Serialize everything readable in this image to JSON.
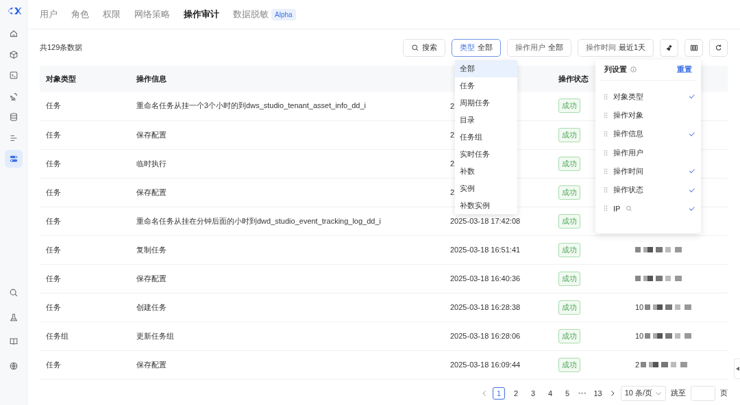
{
  "sidebar": {
    "items": [
      {
        "kind": "home",
        "selected": false
      },
      {
        "kind": "cube",
        "selected": false
      },
      {
        "kind": "terminal",
        "selected": false
      },
      {
        "kind": "dish",
        "selected": false
      },
      {
        "kind": "database",
        "selected": false
      },
      {
        "kind": "list",
        "selected": false
      },
      {
        "kind": "toggles",
        "selected": true
      }
    ],
    "bottom_items": [
      {
        "kind": "search"
      },
      {
        "kind": "flask"
      },
      {
        "kind": "book"
      },
      {
        "kind": "globe"
      }
    ]
  },
  "tabs": [
    {
      "label": "用户",
      "selected": false
    },
    {
      "label": "角色",
      "selected": false
    },
    {
      "label": "权限",
      "selected": false
    },
    {
      "label": "网络策略",
      "selected": false
    },
    {
      "label": "操作审计",
      "selected": true
    },
    {
      "label": "数据脱敏",
      "selected": false,
      "badge": "Alpha"
    }
  ],
  "total": "共129条数据",
  "toolbar": {
    "search": "搜索",
    "filters": [
      {
        "label": "类型",
        "value": "全部",
        "active": true
      },
      {
        "label": "操作用户",
        "value": "全部",
        "active": false
      },
      {
        "label": "操作时间",
        "value": "最近1天",
        "active": false
      }
    ]
  },
  "table": {
    "columns": [
      "对象类型",
      "操作信息",
      "操作状态"
    ],
    "rows": [
      {
        "type": "任务",
        "info": "重命名任务从挂一个3个小时的到dws_studio_tenant_asset_info_dd_i",
        "time": "2",
        "status": "成功"
      },
      {
        "type": "任务",
        "info": "保存配置",
        "time": "2",
        "status": "成功"
      },
      {
        "type": "任务",
        "info": "临时执行",
        "time": "2",
        "status": "成功"
      },
      {
        "type": "任务",
        "info": "保存配置",
        "time": "2",
        "status": "成功"
      },
      {
        "type": "任务",
        "info": "重命名任务从挂在分钟后面的小时到dwd_studio_event_tracking_log_dd_i",
        "time": "2025-03-18 17:42:08",
        "status": "成功"
      },
      {
        "type": "任务",
        "info": "复制任务",
        "time": "2025-03-18 16:51:41",
        "status": "成功",
        "ip_hidden": true
      },
      {
        "type": "任务",
        "info": "保存配置",
        "time": "2025-03-18 16:40:36",
        "status": "成功",
        "ip_hidden": true
      },
      {
        "type": "任务",
        "info": "创建任务",
        "time": "2025-03-18 16:28:38",
        "status": "成功",
        "ip_hidden": true,
        "ip_prefix": "10"
      },
      {
        "type": "任务组",
        "info": "更新任务组",
        "time": "2025-03-18 16:28:06",
        "status": "成功",
        "ip_hidden": true,
        "ip_prefix": "10"
      },
      {
        "type": "任务",
        "info": "保存配置",
        "time": "2025-03-18 16:09:44",
        "status": "成功",
        "ip_hidden": true,
        "ip_prefix": "2"
      }
    ]
  },
  "type_dropdown": {
    "options": [
      {
        "label": "全部",
        "selected": true
      },
      {
        "label": "任务",
        "selected": false
      },
      {
        "label": "周期任务",
        "selected": false
      },
      {
        "label": "目录",
        "selected": false
      },
      {
        "label": "任务组",
        "selected": false
      },
      {
        "label": "实时任务",
        "selected": false
      },
      {
        "label": "补数",
        "selected": false
      },
      {
        "label": "实例",
        "selected": false
      },
      {
        "label": "补数实例",
        "selected": false
      }
    ]
  },
  "column_settings": {
    "title": "列设置",
    "reset": "重置",
    "items": [
      {
        "label": "对象类型",
        "checked": true,
        "searchable": false
      },
      {
        "label": "操作对象",
        "checked": false,
        "searchable": false
      },
      {
        "label": "操作信息",
        "checked": true,
        "searchable": false
      },
      {
        "label": "操作用户",
        "checked": false,
        "searchable": false
      },
      {
        "label": "操作时间",
        "checked": true,
        "searchable": false
      },
      {
        "label": "操作状态",
        "checked": true,
        "searchable": false
      },
      {
        "label": "IP",
        "checked": true,
        "searchable": true
      }
    ]
  },
  "pagination": {
    "pages": [
      {
        "label": "1",
        "selected": true
      },
      {
        "label": "2",
        "selected": false
      },
      {
        "label": "3",
        "selected": false
      },
      {
        "label": "4",
        "selected": false
      },
      {
        "label": "5",
        "selected": false
      }
    ],
    "ellipsis": "•••",
    "last": "13",
    "page_size": "10 条/页",
    "jump_label": "跳至",
    "page_suffix": "页"
  }
}
